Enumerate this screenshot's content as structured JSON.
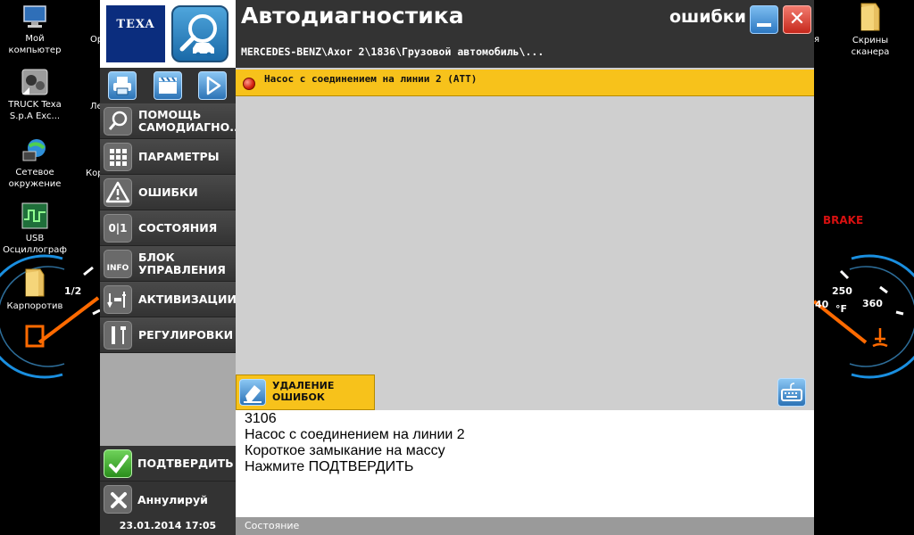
{
  "desktop": {
    "icons": [
      {
        "label_1": "Мой",
        "label_2": "компьютер"
      },
      {
        "label_1": "TRUCK Texa",
        "label_2": "S.p.A Exc..."
      },
      {
        "label_1": "Сетевое",
        "label_2": "окружение"
      },
      {
        "label_1": "USB",
        "label_2": "Осциллограф"
      },
      {
        "label_1": "Карпоротив",
        "label_2": ""
      },
      {
        "label_1": "Скрины",
        "label_2": "сканера"
      }
    ],
    "partial_labels": {
      "op": "Ор",
      "le": "Ле",
      "kor": "Кор",
      "ya": "я"
    },
    "fuel_gauge": {
      "mark": "1/2"
    },
    "temp_gauge": {
      "mark_250": "250",
      "mark_360": "360",
      "unit": "°F",
      "partial": "40",
      "warning": "BRAKE"
    }
  },
  "app": {
    "brand": "TEXA",
    "title": "Автодиагностика",
    "section": "ошибки",
    "breadcrumb": "MERCEDES-BENZ\\Axor 2\\1836\\Грузовой автомобиль\\...",
    "close_symbol": "✕"
  },
  "menu": {
    "items": [
      {
        "label": "ПОМОЩЬ САМОДИАГНО...",
        "icon": "magnifier-icon"
      },
      {
        "label": "ПАРАМЕТРЫ",
        "icon": "grid-icon"
      },
      {
        "label": "ОШИБКИ",
        "icon": "warning-icon"
      },
      {
        "label": "СОСТОЯНИЯ",
        "icon": "state-icon"
      },
      {
        "label": "БЛОК УПРАВЛЕНИЯ",
        "icon": "info-icon"
      },
      {
        "label": "АКТИВИЗАЦИИ",
        "icon": "activation-icon"
      },
      {
        "label": "РЕГУЛИРОВКИ",
        "icon": "tools-icon"
      }
    ],
    "icon_texts": {
      "state": "0|1",
      "info": "INFO"
    }
  },
  "commands": {
    "confirm": "ПОДТВЕРДИТЬ",
    "cancel": "Аннулируй"
  },
  "datetime": "23.01.2014  17:05",
  "errors": [
    {
      "text": "Насос с соединением на линии 2  (АТТ)",
      "color": "#d3200f"
    }
  ],
  "clear_button": {
    "line_1": "УДАЛЕНИЕ",
    "line_2": "ОШИБОК"
  },
  "details": {
    "lines": [
      "3106",
      "Насос с соединением на линии 2",
      "Короткое замыкание на массу",
      "Нажмите ПОДТВЕРДИТЬ"
    ]
  },
  "status_bar": "Состояние",
  "colors": {
    "accent_yellow": "#f7c21b",
    "header_dark": "#333333",
    "confirm_green": "#3aa82a",
    "brand_blue": "#0b2d7e"
  }
}
